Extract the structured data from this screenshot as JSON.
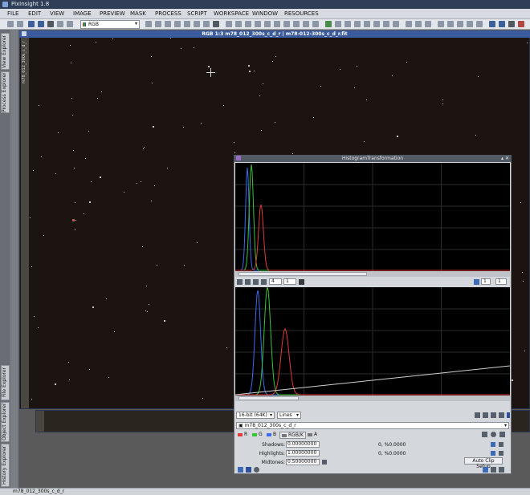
{
  "app": {
    "title": "PixInsight 1.8"
  },
  "menu": {
    "items": [
      "FILE",
      "EDIT",
      "VIEW",
      "IMAGE",
      "PREVIEW",
      "MASK",
      "PROCESS",
      "SCRIPT",
      "WORKSPACE",
      "WINDOW",
      "RESOURCES"
    ]
  },
  "toolbar": {
    "color_space": "RGB"
  },
  "left_dock": {
    "tabs": [
      "View Explorer",
      "Process Explorer",
      "File Explorer",
      "Object Explorer",
      "History Explorer"
    ]
  },
  "image_window": {
    "title": "RGB 1:3 m78_012_300s_c_d_r | m78-012-300s_c_d_r.fit",
    "side_label": "m78_012_300s_c_d_r"
  },
  "histogram": {
    "title": "HistogramTransformation",
    "zoom_h": "4",
    "zoom_v": "1",
    "right_spin_a": "1",
    "right_spin_b": "1",
    "bit_depth": "16-bit (64K)",
    "display_mode": "Lines",
    "view": "m78_012_300s_c_d_r",
    "channels": {
      "r": "R",
      "g": "G",
      "b": "B",
      "rgbk": "RGB/K",
      "a": "A"
    },
    "fields": {
      "shadows_label": "Shadows:",
      "shadows_value": "0.00000000",
      "shadows_stat": "0, %0.0000",
      "highlights_label": "Highlights:",
      "highlights_value": "1.00000000",
      "highlights_stat": "0, %0.0000",
      "midtones_label": "Midtones:",
      "midtones_value": "0.50000000"
    },
    "auto_clip_label": "Auto Clip Setup",
    "colors": {
      "red": "#e03a3a",
      "green": "#37c437",
      "blue": "#3c6df0",
      "curve": "#d0d0d0"
    }
  },
  "status": {
    "view": "m78_012_300s_c_d_r"
  }
}
